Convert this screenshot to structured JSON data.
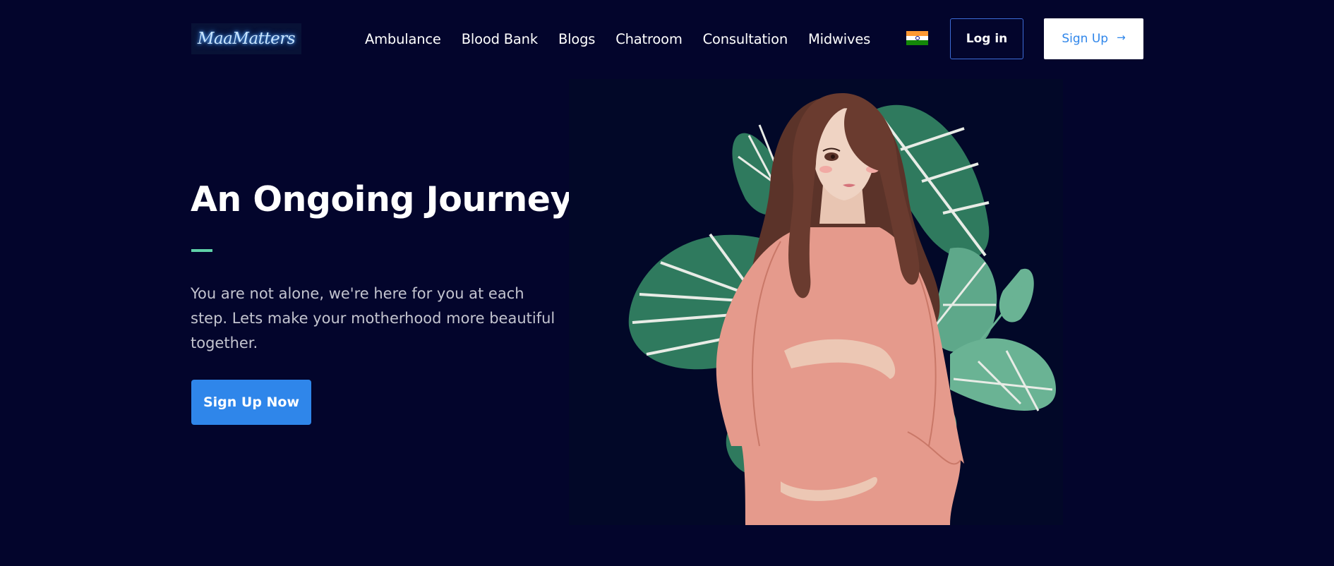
{
  "header": {
    "logo_text": "MaaMatters",
    "nav": [
      "Ambulance",
      "Blood Bank",
      "Blogs",
      "Chatroom",
      "Consultation",
      "Midwives"
    ],
    "language_flag": "india-flag-icon",
    "login_label": "Log in",
    "signup_label": "Sign Up",
    "signup_icon": "arrow-right-icon"
  },
  "hero": {
    "title": "An Ongoing Journey",
    "description": "You are not alone, we're here for you at each step. Lets make your motherhood more beautiful together.",
    "cta_label": "Sign Up Now",
    "illustration": "pregnant-woman-illustration"
  },
  "colors": {
    "background": "#03052c",
    "accent_blue": "#2f86ea",
    "accent_green": "#5fd1a8",
    "body_text": "#c3c4cf"
  }
}
